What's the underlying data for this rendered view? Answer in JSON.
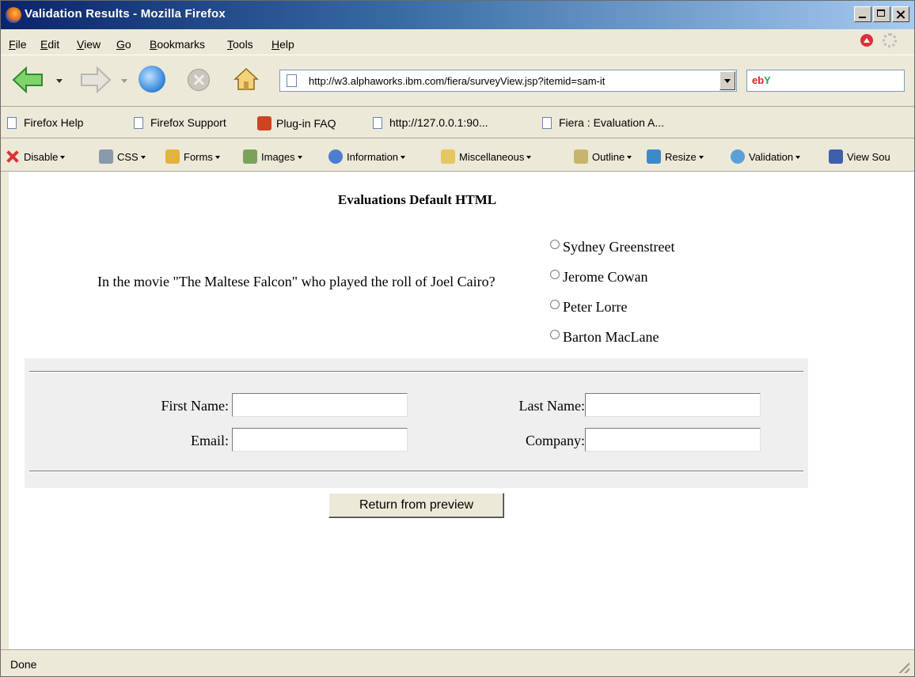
{
  "window": {
    "title": "Validation Results - Mozilla Firefox"
  },
  "menu": [
    {
      "label": "File",
      "u": "F",
      "rest": "ile"
    },
    {
      "label": "Edit",
      "u": "E",
      "rest": "dit"
    },
    {
      "label": "View",
      "u": "V",
      "rest": "iew"
    },
    {
      "label": "Go",
      "u": "G",
      "rest": "o"
    },
    {
      "label": "Bookmarks",
      "u": "B",
      "rest": "ookmarks"
    },
    {
      "label": "Tools",
      "u": "T",
      "rest": "ools"
    },
    {
      "label": "Help",
      "u": "H",
      "rest": "elp"
    }
  ],
  "navbar": {
    "url": "http://w3.alphaworks.ibm.com/fiera/surveyView.jsp?itemid=sam-it",
    "search_engine_a": "eb",
    "search_engine_b": "Y"
  },
  "bookmarks": [
    {
      "label": "Firefox Help",
      "icon": "page-icon"
    },
    {
      "label": "Firefox Support",
      "icon": "page-icon"
    },
    {
      "label": "Plug-in FAQ",
      "icon": "plugin-icon"
    },
    {
      "label": "http://127.0.0.1:90...",
      "icon": "page-icon"
    },
    {
      "label": "Fiera : Evaluation A...",
      "icon": "page-icon"
    }
  ],
  "devbar": [
    {
      "label": "Disable",
      "icon": "disable-icon"
    },
    {
      "label": "CSS",
      "icon": "css-icon"
    },
    {
      "label": "Forms",
      "icon": "forms-icon"
    },
    {
      "label": "Images",
      "icon": "images-icon"
    },
    {
      "label": "Information",
      "icon": "information-icon"
    },
    {
      "label": "Miscellaneous",
      "icon": "miscellaneous-icon"
    },
    {
      "label": "Outline",
      "icon": "outline-icon"
    },
    {
      "label": "Resize",
      "icon": "resize-icon"
    },
    {
      "label": "Validation",
      "icon": "validation-icon"
    },
    {
      "label": "View Sou",
      "icon": "view-source-icon"
    }
  ],
  "page": {
    "title": "Evaluations Default HTML",
    "question": "In the movie \"The Maltese Falcon\" who played the roll of Joel Cairo?",
    "options": [
      "Sydney Greenstreet",
      "Jerome Cowan",
      "Peter Lorre",
      "Barton MacLane"
    ],
    "form": {
      "first_name_label": "First Name:",
      "last_name_label": "Last Name:",
      "email_label": "Email:",
      "company_label": "Company:"
    },
    "return_button": "Return from preview"
  },
  "status": {
    "text": "Done"
  },
  "colors": {
    "title_bar_start": "#0a246a",
    "title_bar_end": "#a6caf0",
    "chrome": "#ece9d8",
    "form_bg": "#efefef"
  }
}
